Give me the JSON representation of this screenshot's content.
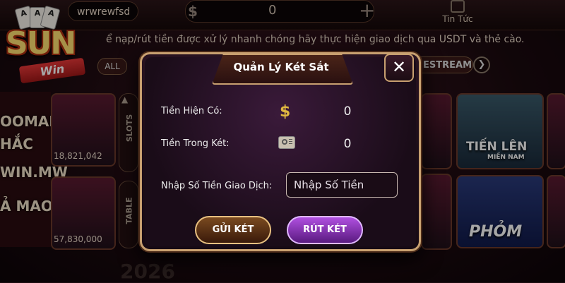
{
  "header": {
    "username": "wrwrewfsd",
    "balance_icon": "dollar-icon",
    "balance_value": "0",
    "add_icon": "plus-icon",
    "news_label": "Tin Tức"
  },
  "logo": {
    "brand": "SUN",
    "sub": "Win",
    "cards": [
      "A",
      "A",
      "A"
    ]
  },
  "marquee": "ể nạp/rút tiền được xử lý nhanh chóng hãy thực hiện giao dịch qua USDT và thẻ cào.",
  "lobby": {
    "tab_all": "ALL",
    "left_text": [
      "OOMAIN",
      "HẮC",
      "WIN.MW",
      "Ả MAO"
    ],
    "sidebar_labels": [
      "SLOTS",
      "TABLE"
    ],
    "game_counts": [
      "18,821,042",
      "57,830,000"
    ],
    "right_tab": "ESTREAM",
    "right_titles": [
      "TIẾN LÊN",
      "MIỀN NAM",
      "PHỎM"
    ],
    "year": "2026"
  },
  "modal": {
    "title": "Quản Lý Két Sắt",
    "close_label": "✕",
    "current_label": "Tiền Hiện Có:",
    "current_value": "0",
    "safe_label": "Tiền Trong Két:",
    "safe_value": "0",
    "amount_label": "Nhập Số Tiền Giao Dịch:",
    "amount_placeholder": "Nhập Số Tiền",
    "deposit_label": "GỬI KÉT",
    "withdraw_label": "RÚT KÉT"
  },
  "colors": {
    "gold": "#c8a070",
    "purple_button": "#8a30c0",
    "brown_button": "#5a3010"
  }
}
